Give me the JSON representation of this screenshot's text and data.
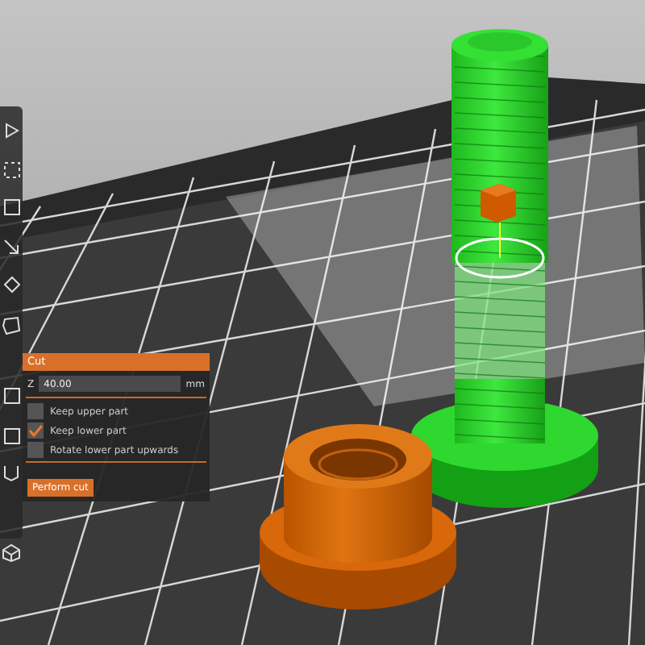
{
  "cut_panel": {
    "title": "Cut",
    "z_field": {
      "label": "Z",
      "value": "40.00",
      "unit": "mm"
    },
    "options": [
      {
        "label": "Keep upper part",
        "checked": false
      },
      {
        "label": "Keep lower part",
        "checked": true
      },
      {
        "label": "Rotate lower part upwards",
        "checked": false
      }
    ],
    "button": "Perform cut"
  }
}
